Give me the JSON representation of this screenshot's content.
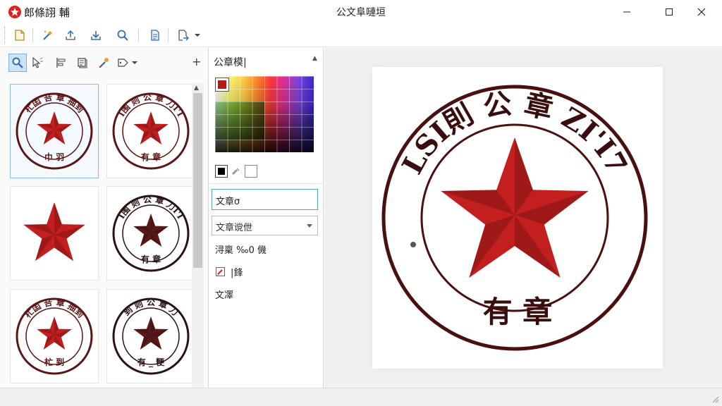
{
  "app": {
    "name": "郎條詡 輔",
    "window_title": "公文阜嗹垣"
  },
  "window_controls": {
    "minimize": "minimize",
    "maximize": "maximize",
    "close": "close"
  },
  "colors": {
    "accent": "#d9241f",
    "stamp_red": "#c41f1f",
    "stamp_dark": "#5a1616",
    "selection": "#5b9bd5"
  },
  "toolbar": {
    "icons": [
      "new-file-icon",
      "wand-icon",
      "upload-icon",
      "download-icon",
      "search-icon",
      "document-icon",
      "export-icon"
    ]
  },
  "left_panel": {
    "plus_label": "+",
    "stamps": [
      {
        "kind": "round-star",
        "top_text": "杧囯 咅 章 抽到",
        "bottom_text": "巾 羽"
      },
      {
        "kind": "round-star",
        "top_text": "I围 则 公 章 刀I'I",
        "bottom_text": "有 章"
      },
      {
        "kind": "star-only",
        "top_text": "",
        "bottom_text": ""
      },
      {
        "kind": "round-star-dark",
        "top_text": "I围 则 公 章 刀I'I",
        "bottom_text": "有 章"
      },
      {
        "kind": "round-star",
        "top_text": "杧囯 咅 章 抽到",
        "bottom_text": "杧 到"
      },
      {
        "kind": "round-star-dark",
        "top_text": "到 则 公 章 刀",
        "bottom_text": "有 _ 粳"
      }
    ]
  },
  "middle_panel": {
    "title": "公章模|",
    "text_input_value": "文章σ",
    "select_value": "文章谠伳",
    "size_label": "浔稟 ‰0 僟",
    "edit_label": "|鋒",
    "text_label": "文凙"
  },
  "preview": {
    "top_text": "LSI則 公 章 ZI'I7",
    "bottom_text": "有 章"
  }
}
